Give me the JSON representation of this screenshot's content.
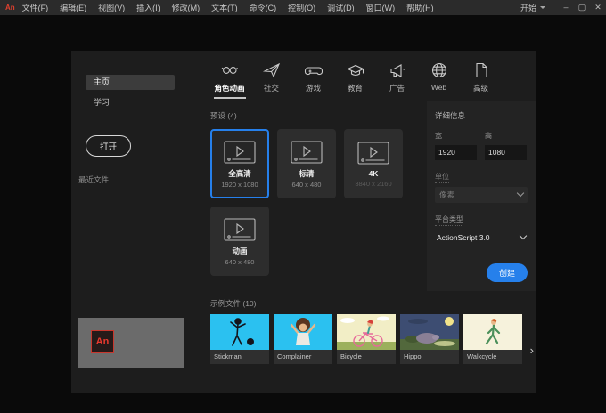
{
  "titlebar": {
    "logo": "An",
    "menus": [
      "文件(F)",
      "编辑(E)",
      "视图(V)",
      "插入(I)",
      "修改(M)",
      "文本(T)",
      "命令(C)",
      "控制(O)",
      "调试(D)",
      "窗口(W)",
      "帮助(H)"
    ],
    "workspace": "开始",
    "window_controls": {
      "minimize": "–",
      "maximize": "▢",
      "close": "✕"
    }
  },
  "sidebar": {
    "items": [
      {
        "label": "主页"
      },
      {
        "label": "学习"
      }
    ],
    "open_button": "打开",
    "recent_label": "最近文件",
    "logo_text": "An"
  },
  "tabs": [
    {
      "label": "角色动画"
    },
    {
      "label": "社交"
    },
    {
      "label": "游戏"
    },
    {
      "label": "教育"
    },
    {
      "label": "广告"
    },
    {
      "label": "Web"
    },
    {
      "label": "高级"
    }
  ],
  "presets": {
    "heading": "预设 (4)",
    "items": [
      {
        "name": "全高清",
        "size": "1920 x 1080"
      },
      {
        "name": "标清",
        "size": "640 x 480"
      },
      {
        "name": "4K",
        "size": "3840 x 2160"
      },
      {
        "name": "动画",
        "size": "640 x 480"
      }
    ]
  },
  "details": {
    "heading": "详细信息",
    "width_label": "宽",
    "width_value": "1920",
    "height_label": "高",
    "height_value": "1080",
    "unit_label": "单位",
    "unit_value": "像素",
    "platform_label": "平台类型",
    "platform_value": "ActionScript 3.0",
    "create_button": "创建"
  },
  "samples": {
    "heading": "示例文件 (10)",
    "items": [
      {
        "label": "Stickman"
      },
      {
        "label": "Complainer"
      },
      {
        "label": "Bicycle"
      },
      {
        "label": "Hippo"
      },
      {
        "label": "Walkcycle"
      }
    ],
    "next_arrow": "›"
  },
  "colors": {
    "accent_blue": "#2680eb",
    "panel_bg": "#1d1d1d",
    "titlebar_bg": "#2b2b2b",
    "logo_red": "#e0402e",
    "thumb_cyan": "#2bc1f0"
  }
}
